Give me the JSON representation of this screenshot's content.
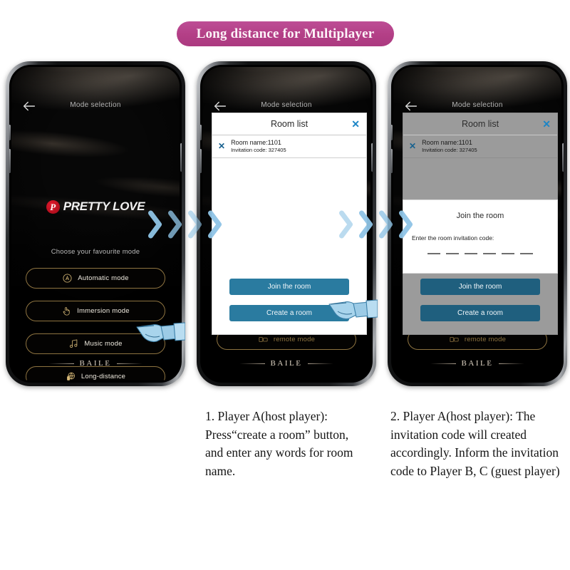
{
  "banner": {
    "text": "Long distance for Multiplayer"
  },
  "phone1": {
    "title": "Mode selection",
    "back_icon": "back-arrow-icon",
    "brand_mark": "P",
    "brand": "PRETTY LOVE",
    "subtitle": "Choose your favourite mode",
    "modes": [
      {
        "label": "Automatic mode",
        "icon": "letter-a-circle-icon"
      },
      {
        "label": "Immersion mode",
        "icon": "hand-pointing-icon"
      },
      {
        "label": "Music mode",
        "icon": "music-note-icon"
      },
      {
        "label": "Long-distance",
        "icon": "globe-icon"
      }
    ],
    "footer_brand": "BAILE"
  },
  "phone2": {
    "title": "Mode selection",
    "footer_brand": "BAILE",
    "remote_mode_label": "remote mode",
    "dialog": {
      "title": "Room list",
      "close_icon": "close-x-icon",
      "rows": [
        {
          "remove_icon": "remove-x-icon",
          "name": "Room name:1101",
          "code": "Invitation code:  327405"
        }
      ],
      "buttons": [
        {
          "label": "Join the room"
        },
        {
          "label": "Create a room"
        }
      ]
    }
  },
  "phone3": {
    "title": "Mode selection",
    "footer_brand": "BAILE",
    "remote_mode_label": "remote mode",
    "dialog": {
      "title": "Room list",
      "close_icon": "close-x-icon",
      "rows": [
        {
          "remove_icon": "remove-x-icon",
          "name": "Room name:1101",
          "code": "Invitation code:  327405"
        }
      ],
      "buttons": [
        {
          "label": "Join the room"
        },
        {
          "label": "Create a room"
        }
      ]
    },
    "join_sheet": {
      "title": "Join the room",
      "label": "Enter the room invitation code:",
      "digit_count": 6
    }
  },
  "captions": {
    "step1": "1. Player A(host player): Press“create a room” button, and enter any words for room name.",
    "step2": "2. Player A(host player): The invitation code will created accordingly. Inform the invitation code to Player B, C (guest player)"
  },
  "colors": {
    "banner": "#b33f86",
    "button_teal": "#2a7ba0",
    "button_teal_dark": "#1f5f7e",
    "accent_gold": "#8d7340",
    "close_blue": "#1c85c6",
    "chevron_blue": "#9ecbe8",
    "hand_blue": "#a8d4ec"
  }
}
